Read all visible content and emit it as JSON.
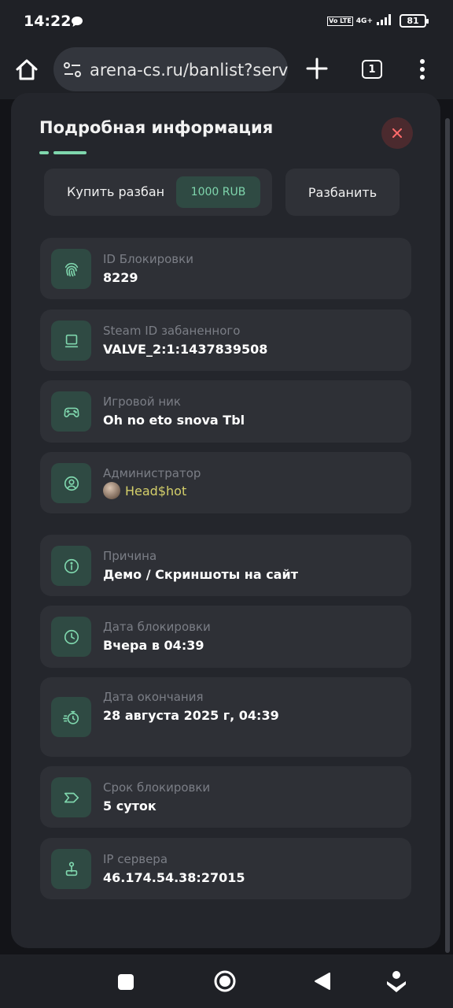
{
  "status_bar": {
    "time": "14:22",
    "network_type": "4G+",
    "volte": "Vo LTE",
    "battery": "81"
  },
  "browser": {
    "url": "arena-cs.ru/banlist?server=",
    "tab_count": "1"
  },
  "modal": {
    "title": "Подробная информация",
    "buy_unban_label": "Купить разбан",
    "price": "1000 RUB",
    "unban_label": "Разбанить",
    "accent_color": "#7fd6ad",
    "fields": [
      {
        "label": "ID Блокировки",
        "value": "8229",
        "icon": "fingerprint-icon"
      },
      {
        "label": "Steam ID забаненного",
        "value": "VALVE_2:1:1437839508",
        "icon": "monitor-icon"
      },
      {
        "label": "Игровой ник",
        "value": "Oh no eto snova Tbl",
        "icon": "gamepad-icon"
      },
      {
        "label": "Администратор",
        "value": "Head$hot",
        "icon": "user-circle-icon"
      },
      {
        "label": "Причина",
        "value": "Демо / Скриншоты на сайт",
        "icon": "info-icon"
      },
      {
        "label": "Дата блокировки",
        "value": "Вчера в 04:39",
        "icon": "clock-icon"
      },
      {
        "label": "Дата окончания",
        "value": "28 августа 2025 г, 04:39",
        "icon": "timer-icon"
      },
      {
        "label": "Срок блокировки",
        "value": "5 суток",
        "icon": "tag-arrow-icon"
      },
      {
        "label": "IP сервера",
        "value": "46.174.54.38:27015",
        "icon": "joystick-icon"
      }
    ]
  }
}
